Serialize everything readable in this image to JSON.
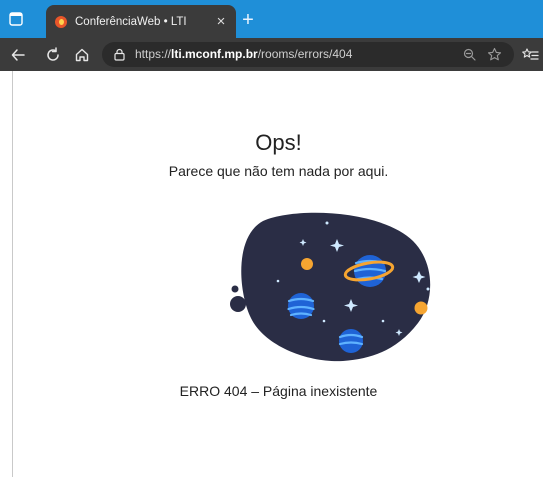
{
  "browser": {
    "tab": {
      "title": "ConferênciaWeb • LTI",
      "close": "×"
    },
    "new_tab": "+",
    "address": {
      "prefix": "https://",
      "host": "lti.mconf.mp.br",
      "path": "/rooms/errors/404"
    }
  },
  "page": {
    "title": "Ops!",
    "subtitle": "Parece que não tem nada por aqui.",
    "error": "ERRO 404 – Página inexistente"
  },
  "colors": {
    "tab_strip": "#1f8fd8",
    "toolbar": "#3b3b3b",
    "illustration_blob": "#2a2d45",
    "planet_blue": "#1f63d6",
    "planet_orange": "#f6a531"
  },
  "icons": [
    "window-icon",
    "favicon-icon",
    "back-icon",
    "reload-icon",
    "home-icon",
    "site-info-icon",
    "zoom-icon",
    "favorite-star-icon",
    "favorites-list-icon"
  ]
}
